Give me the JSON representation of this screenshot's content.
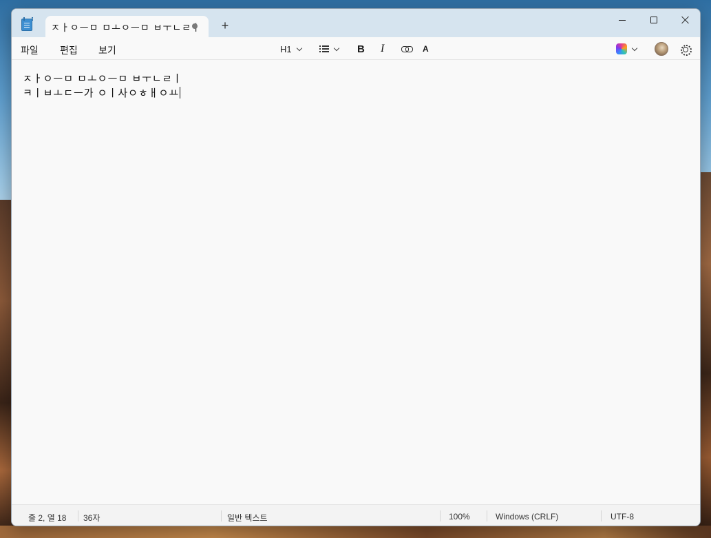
{
  "window": {
    "tab_title": "ㅈㅏㅇㅡㅁ ㅁㅗㅇㅡㅁ ㅂㅜㄴㄹㅣ",
    "new_tab_label": "+",
    "controls": {
      "minimize": "minimize",
      "maximize": "maximize",
      "close": "close"
    }
  },
  "menu": {
    "file": "파일",
    "edit": "편집",
    "view": "보기"
  },
  "toolbar": {
    "heading": "H1",
    "list_icon": "bulleted-list-icon",
    "bold": "B",
    "italic": "I",
    "link_icon": "link-icon",
    "clear_format": "A",
    "copilot_icon": "copilot-icon",
    "avatar_icon": "profile-avatar",
    "settings_icon": "gear-icon"
  },
  "editor": {
    "lines": [
      "ㅈㅏㅇㅡㅁ ㅁㅗㅇㅡㅁ ㅂㅜㄴㄹㅣ",
      "ㅋㅣㅂㅗㄷㅡ가 ㅇㅣ사ㅇㅎㅐㅇㅛ"
    ]
  },
  "status": {
    "position": "줄 2, 열 18",
    "char_count": "36자",
    "mode": "일반 텍스트",
    "zoom": "100%",
    "line_ending": "Windows (CRLF)",
    "encoding": "UTF-8"
  },
  "colors": {
    "titlebar": "#d6e4ef",
    "editor_bg": "#f9f9f9",
    "statusbar": "#f3f3f3"
  }
}
